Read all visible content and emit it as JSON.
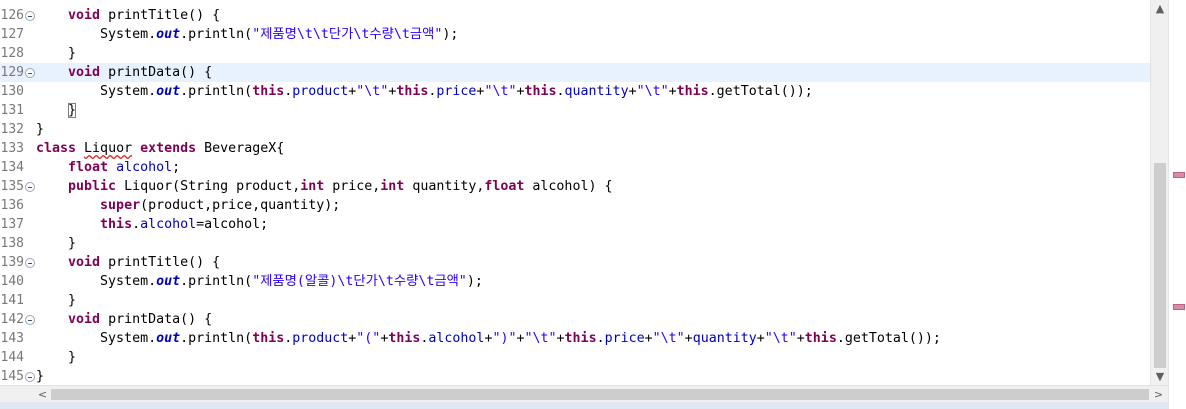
{
  "editor": {
    "lines": [
      {
        "num": "126",
        "fold": true,
        "hl": false,
        "parts": [
          [
            "t",
            "    "
          ],
          [
            "k",
            "void"
          ],
          [
            "t",
            " printTitle() {"
          ]
        ]
      },
      {
        "num": "127",
        "fold": false,
        "hl": false,
        "parts": [
          [
            "t",
            "        System."
          ],
          [
            "fi",
            "out"
          ],
          [
            "t",
            ".println("
          ],
          [
            "s",
            "\"제품명\\t\\t단가\\t수량\\t금액\""
          ],
          [
            "t",
            ");"
          ]
        ]
      },
      {
        "num": "128",
        "fold": false,
        "hl": false,
        "parts": [
          [
            "t",
            "    }"
          ]
        ]
      },
      {
        "num": "129",
        "fold": true,
        "hl": true,
        "parts": [
          [
            "t",
            "    "
          ],
          [
            "k",
            "void"
          ],
          [
            "t",
            " printData() {"
          ]
        ]
      },
      {
        "num": "130",
        "fold": false,
        "hl": false,
        "parts": [
          [
            "t",
            "        System."
          ],
          [
            "fi",
            "out"
          ],
          [
            "t",
            ".println("
          ],
          [
            "k",
            "this"
          ],
          [
            "t",
            "."
          ],
          [
            "f",
            "product"
          ],
          [
            "t",
            "+"
          ],
          [
            "s",
            "\"\\t\""
          ],
          [
            "t",
            "+"
          ],
          [
            "k",
            "this"
          ],
          [
            "t",
            "."
          ],
          [
            "f",
            "price"
          ],
          [
            "t",
            "+"
          ],
          [
            "s",
            "\"\\t\""
          ],
          [
            "t",
            "+"
          ],
          [
            "k",
            "this"
          ],
          [
            "t",
            "."
          ],
          [
            "f",
            "quantity"
          ],
          [
            "t",
            "+"
          ],
          [
            "s",
            "\"\\t\""
          ],
          [
            "t",
            "+"
          ],
          [
            "k",
            "this"
          ],
          [
            "t",
            ".getTotal());"
          ]
        ]
      },
      {
        "num": "131",
        "fold": false,
        "hl": false,
        "parts": [
          [
            "t",
            "    "
          ],
          [
            "b",
            "}"
          ]
        ]
      },
      {
        "num": "132",
        "fold": false,
        "hl": false,
        "parts": [
          [
            "t",
            "}"
          ]
        ]
      },
      {
        "num": "133",
        "fold": false,
        "hl": false,
        "parts": [
          [
            "k",
            "class"
          ],
          [
            "t",
            " "
          ],
          [
            "w",
            "Liquor"
          ],
          [
            "t",
            " "
          ],
          [
            "k",
            "extends"
          ],
          [
            "t",
            " BeverageX{"
          ]
        ]
      },
      {
        "num": "134",
        "fold": false,
        "hl": false,
        "parts": [
          [
            "t",
            "    "
          ],
          [
            "k",
            "float"
          ],
          [
            "t",
            " "
          ],
          [
            "f",
            "alcohol"
          ],
          [
            "t",
            ";"
          ]
        ]
      },
      {
        "num": "135",
        "fold": true,
        "hl": false,
        "parts": [
          [
            "t",
            "    "
          ],
          [
            "k",
            "public"
          ],
          [
            "t",
            " Liquor(String product,"
          ],
          [
            "k",
            "int"
          ],
          [
            "t",
            " price,"
          ],
          [
            "k",
            "int"
          ],
          [
            "t",
            " quantity,"
          ],
          [
            "k",
            "float"
          ],
          [
            "t",
            " alcohol) {"
          ]
        ]
      },
      {
        "num": "136",
        "fold": false,
        "hl": false,
        "parts": [
          [
            "t",
            "        "
          ],
          [
            "k",
            "super"
          ],
          [
            "t",
            "(product,price,quantity);"
          ]
        ]
      },
      {
        "num": "137",
        "fold": false,
        "hl": false,
        "parts": [
          [
            "t",
            "        "
          ],
          [
            "k",
            "this"
          ],
          [
            "t",
            "."
          ],
          [
            "f",
            "alcohol"
          ],
          [
            "t",
            "=alcohol;"
          ]
        ]
      },
      {
        "num": "138",
        "fold": false,
        "hl": false,
        "parts": [
          [
            "t",
            "    }"
          ]
        ]
      },
      {
        "num": "139",
        "fold": true,
        "hl": false,
        "parts": [
          [
            "t",
            "    "
          ],
          [
            "k",
            "void"
          ],
          [
            "t",
            " printTitle() {"
          ]
        ]
      },
      {
        "num": "140",
        "fold": false,
        "hl": false,
        "parts": [
          [
            "t",
            "        System."
          ],
          [
            "fi",
            "out"
          ],
          [
            "t",
            ".println("
          ],
          [
            "s",
            "\"제품명(알콜)\\t단가\\t수량\\t금액\""
          ],
          [
            "t",
            ");"
          ]
        ]
      },
      {
        "num": "141",
        "fold": false,
        "hl": false,
        "parts": [
          [
            "t",
            "    }"
          ]
        ]
      },
      {
        "num": "142",
        "fold": true,
        "hl": false,
        "parts": [
          [
            "t",
            "    "
          ],
          [
            "k",
            "void"
          ],
          [
            "t",
            " printData() {"
          ]
        ]
      },
      {
        "num": "143",
        "fold": false,
        "hl": false,
        "parts": [
          [
            "t",
            "        System."
          ],
          [
            "fi",
            "out"
          ],
          [
            "t",
            ".println("
          ],
          [
            "k",
            "this"
          ],
          [
            "t",
            "."
          ],
          [
            "f",
            "product"
          ],
          [
            "t",
            "+"
          ],
          [
            "s",
            "\"(\""
          ],
          [
            "t",
            "+"
          ],
          [
            "k",
            "this"
          ],
          [
            "t",
            "."
          ],
          [
            "f",
            "alcohol"
          ],
          [
            "t",
            "+"
          ],
          [
            "s",
            "\")\""
          ],
          [
            "t",
            "+"
          ],
          [
            "s",
            "\"\\t\""
          ],
          [
            "t",
            "+"
          ],
          [
            "k",
            "this"
          ],
          [
            "t",
            "."
          ],
          [
            "f",
            "price"
          ],
          [
            "t",
            "+"
          ],
          [
            "s",
            "\"\\t\""
          ],
          [
            "t",
            "+"
          ],
          [
            "f",
            "quantity"
          ],
          [
            "t",
            "+"
          ],
          [
            "s",
            "\"\\t\""
          ],
          [
            "t",
            "+"
          ],
          [
            "k",
            "this"
          ],
          [
            "t",
            ".getTotal());"
          ]
        ]
      },
      {
        "num": "144",
        "fold": false,
        "hl": false,
        "parts": [
          [
            "t",
            "    }"
          ]
        ]
      },
      {
        "num": "145",
        "fold": true,
        "hl": false,
        "parts": [
          [
            "t",
            "}"
          ]
        ]
      }
    ]
  },
  "scrollbars": {
    "vertical_up_icon": "chevron-up-icon",
    "vertical_down_icon": "chevron-down-icon",
    "horizontal_left_icon": "chevron-left-icon",
    "horizontal_right_icon": "chevron-right-icon",
    "up_glyph": "▲",
    "down_glyph": "▼",
    "left_glyph": "<",
    "right_glyph": ">"
  },
  "colors": {
    "keyword": "#7f0055",
    "field": "#0000c0",
    "string": "#2a00ff",
    "current_line": "#e8f2fe",
    "error_underline": "#e02020"
  }
}
